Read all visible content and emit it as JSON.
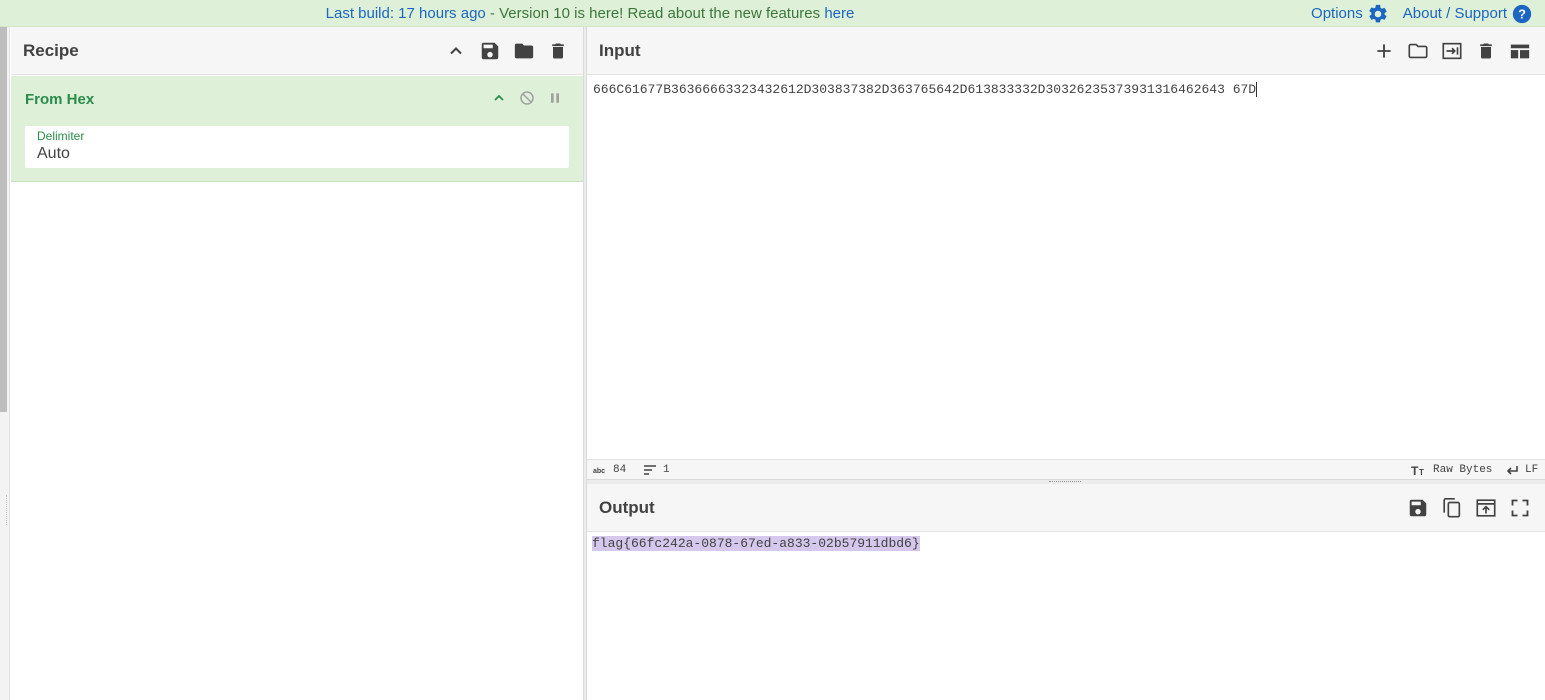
{
  "banner": {
    "message_prefix": "Last build: 17 hours ago",
    "message_middle": " - Version 10 is here! Read about the new features ",
    "message_link": "here",
    "options_label": "Options",
    "about_label": "About / Support"
  },
  "recipe": {
    "title": "Recipe",
    "operations": [
      {
        "name": "From Hex",
        "delimiter_label": "Delimiter",
        "delimiter_value": "Auto"
      }
    ]
  },
  "input": {
    "title": "Input",
    "text": "666C61677B36366663323432612D303837382D363765642D613833332D303262353739313164626436 7D",
    "text_display": "666C61677B36366663323432612D303837382D363765642D613833332D30326235373931316462643 67D",
    "status": {
      "chars": "84",
      "lines": "1",
      "encoding": "Raw Bytes",
      "eol": "LF"
    }
  },
  "output": {
    "title": "Output",
    "text": "flag{66fc242a-0878-67ed-a833-02b57911dbd6}"
  },
  "colors": {
    "banner_bg": "#dff0d8",
    "link": "#1a66c2",
    "op_green": "#2a8c4a",
    "selection": "#d6c8ec"
  },
  "icons": {
    "options": "gear-icon",
    "about": "help-icon",
    "recipe_toolbar": [
      "chevron-up-icon",
      "save-icon",
      "folder-icon",
      "trash-icon"
    ],
    "input_toolbar": [
      "plus-icon",
      "folder-icon",
      "open-input-icon",
      "trash-icon",
      "layout-icon"
    ],
    "output_toolbar": [
      "save-icon",
      "copy-icon",
      "replace-input-icon",
      "fullscreen-icon"
    ],
    "operation": [
      "chevron-up-icon",
      "disable-icon",
      "pause-icon"
    ]
  }
}
